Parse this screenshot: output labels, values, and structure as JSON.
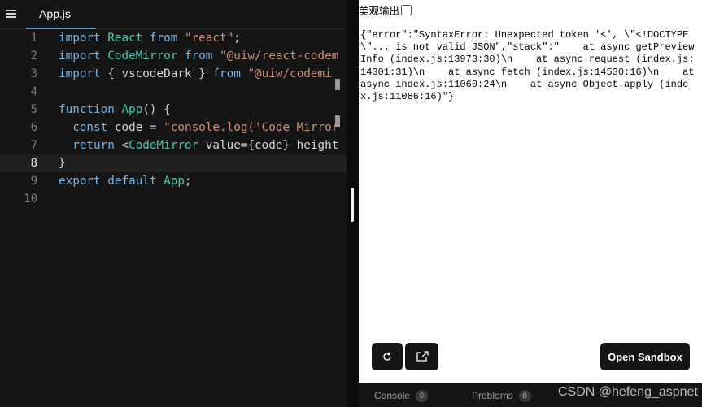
{
  "editor": {
    "tab_label": "App.js",
    "lines": [
      {
        "n": "1",
        "parts": [
          [
            "kw2",
            "import"
          ],
          [
            "plain",
            " "
          ],
          [
            "id",
            "React"
          ],
          [
            "plain",
            " "
          ],
          [
            "kw2",
            "from"
          ],
          [
            "plain",
            " "
          ],
          [
            "str",
            "\"react\""
          ],
          [
            "plain",
            ";"
          ]
        ]
      },
      {
        "n": "2",
        "parts": [
          [
            "kw2",
            "import"
          ],
          [
            "plain",
            " "
          ],
          [
            "id",
            "CodeMirror"
          ],
          [
            "plain",
            " "
          ],
          [
            "kw2",
            "from"
          ],
          [
            "plain",
            " "
          ],
          [
            "str",
            "\"@uiw/react-codem"
          ]
        ]
      },
      {
        "n": "3",
        "parts": [
          [
            "kw2",
            "import"
          ],
          [
            "plain",
            " { vscodeDark } "
          ],
          [
            "kw2",
            "from"
          ],
          [
            "plain",
            " "
          ],
          [
            "str",
            "\"@uiw/codemi"
          ]
        ]
      },
      {
        "n": "4",
        "parts": []
      },
      {
        "n": "5",
        "parts": [
          [
            "kw2",
            "function"
          ],
          [
            "plain",
            " "
          ],
          [
            "id",
            "App"
          ],
          [
            "plain",
            "() {"
          ]
        ]
      },
      {
        "n": "6",
        "parts": [
          [
            "plain",
            "  "
          ],
          [
            "kw2",
            "const"
          ],
          [
            "plain",
            " code = "
          ],
          [
            "str",
            "\"console.log('Code Mirror"
          ]
        ]
      },
      {
        "n": "7",
        "parts": [
          [
            "plain",
            "  "
          ],
          [
            "kw2",
            "return"
          ],
          [
            "plain",
            " <"
          ],
          [
            "id",
            "CodeMirror"
          ],
          [
            "plain",
            " value={code} height"
          ]
        ]
      },
      {
        "n": "8",
        "parts": [
          [
            "plain",
            "}"
          ]
        ]
      },
      {
        "n": "9",
        "parts": [
          [
            "kw2",
            "export"
          ],
          [
            "plain",
            " "
          ],
          [
            "kw2",
            "default"
          ],
          [
            "plain",
            " "
          ],
          [
            "id",
            "App"
          ],
          [
            "plain",
            ";"
          ]
        ]
      },
      {
        "n": "10",
        "parts": []
      }
    ]
  },
  "preview": {
    "pretty_label": "美观输出",
    "output": "{\"error\":\"SyntaxError: Unexpected token '<', \\\"<!DOCTYPE \\\"... is not valid JSON\",\"stack\":\"    at async getPreviewInfo (index.js:13973:30)\\n    at async request (index.js:14301:31)\\n    at async fetch (index.js:14530:16)\\n    at async index.js:11060:24\\n    at async Object.apply (index.js:11086:16)\"}",
    "open_sandbox_label": "Open Sandbox",
    "refresh_icon": "refresh-icon",
    "open_icon": "open-external-icon"
  },
  "bottombar": {
    "tabs": [
      {
        "label": "Console",
        "count": "0"
      },
      {
        "label": "Problems",
        "count": "0"
      }
    ]
  },
  "watermark": "CSDN @hefeng_aspnet"
}
